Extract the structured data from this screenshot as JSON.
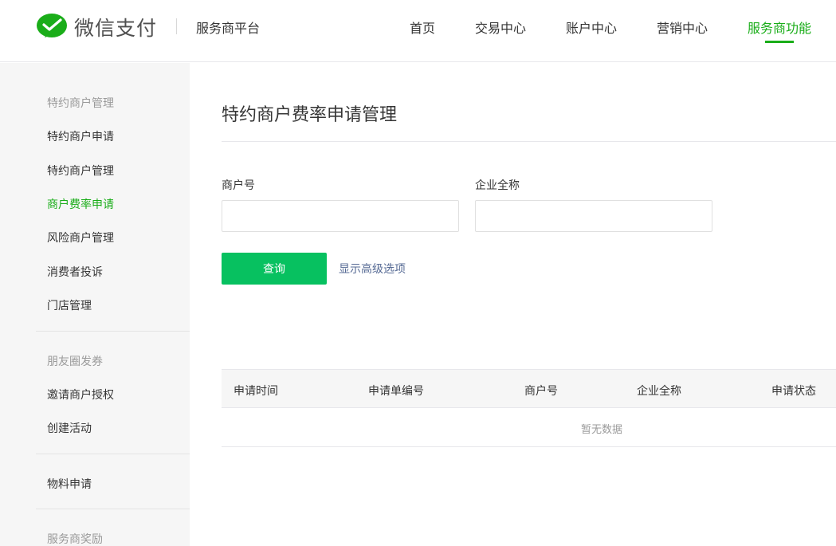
{
  "header": {
    "brand": "微信支付",
    "platform": "服务商平台",
    "nav": [
      "首页",
      "交易中心",
      "账户中心",
      "营销中心",
      "服务商功能"
    ],
    "active_nav": "服务商功能",
    "accent_color": "#1aad19"
  },
  "sidebar": {
    "group1_title": "特约商户管理",
    "group1_items": [
      "特约商户申请",
      "特约商户管理",
      "商户费率申请",
      "风险商户管理",
      "消费者投诉",
      "门店管理"
    ],
    "active_item": "商户费率申请",
    "group2_title": "朋友圈发券",
    "group2_items": [
      "邀请商户授权",
      "创建活动"
    ],
    "group3_items": [
      "物料申请"
    ],
    "group4_title": "服务商奖励"
  },
  "main": {
    "title": "特约商户费率申请管理",
    "fields": {
      "merchant_id_label": "商户号",
      "merchant_id_value": "",
      "company_name_label": "企业全称",
      "company_name_value": ""
    },
    "query_button": "查询",
    "advanced_link": "显示高级选项",
    "table": {
      "columns": [
        "申请时间",
        "申请单编号",
        "商户号",
        "企业全称",
        "申请状态"
      ],
      "rows": [],
      "empty_text": "暂无数据"
    }
  }
}
